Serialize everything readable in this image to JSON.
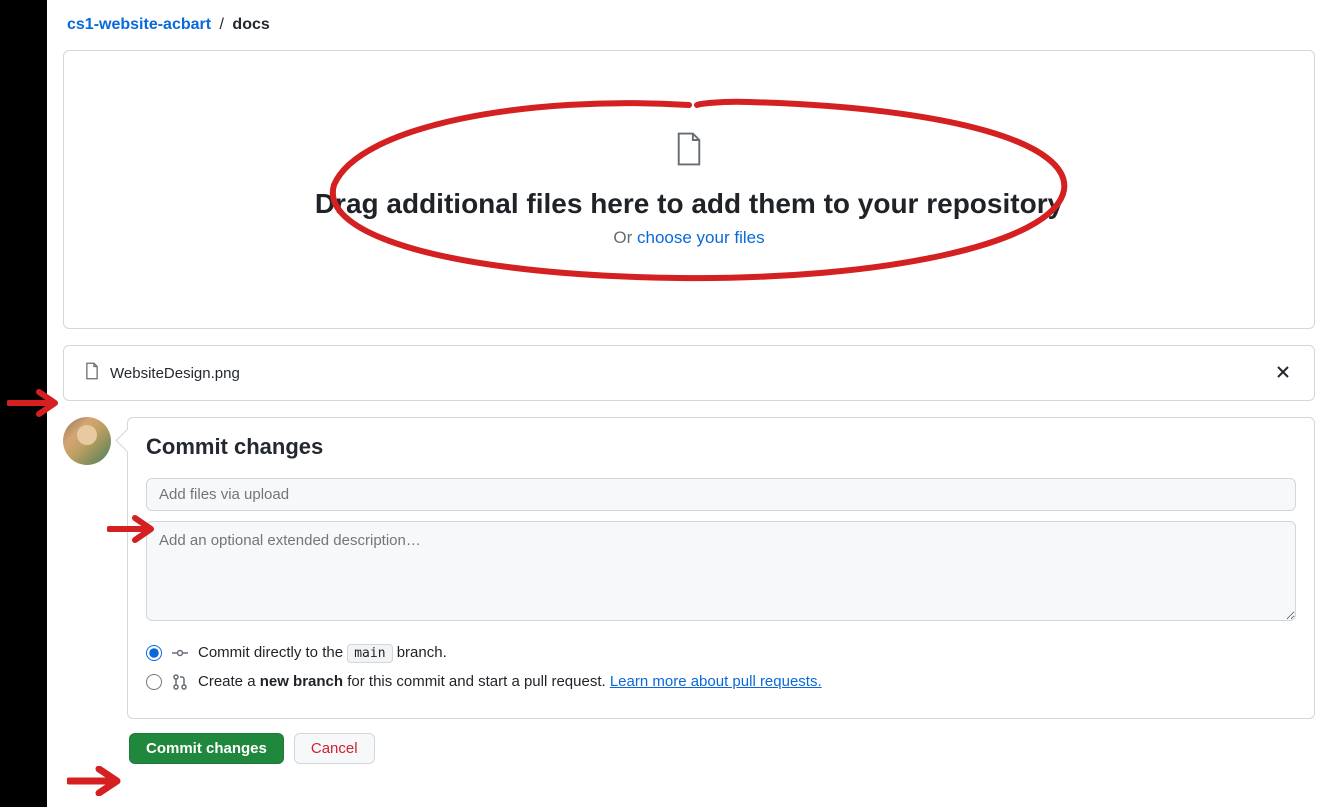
{
  "breadcrumb": {
    "repo": "cs1-website-acbart",
    "separator": "/",
    "path": "docs"
  },
  "upload": {
    "heading": "Drag additional files here to add them to your repository",
    "or_text": "Or ",
    "choose_link": "choose your files"
  },
  "files": [
    {
      "name": "WebsiteDesign.png"
    }
  ],
  "commit": {
    "heading": "Commit changes",
    "summary_placeholder": "Add files via upload",
    "description_placeholder": "Add an optional extended description…",
    "option_direct_prefix": "Commit directly to the ",
    "option_direct_branch": "main",
    "option_direct_suffix": " branch.",
    "option_branch_prefix": "Create a ",
    "option_branch_bold": "new branch",
    "option_branch_suffix": " for this commit and start a pull request. ",
    "option_branch_link": "Learn more about pull requests."
  },
  "actions": {
    "commit": "Commit changes",
    "cancel": "Cancel"
  }
}
